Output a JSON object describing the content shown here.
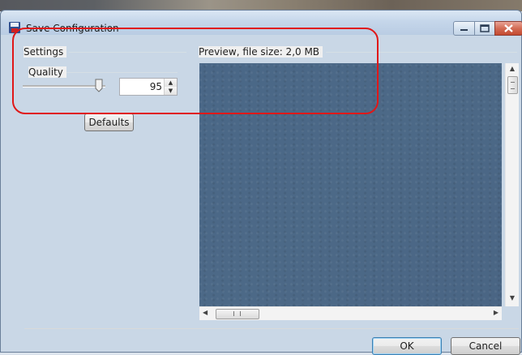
{
  "window": {
    "title": "Save Configuration",
    "icon": "save-icon",
    "controls": {
      "minimize": "minimize-icon",
      "maximize": "maximize-icon",
      "close": "close-icon"
    }
  },
  "settings": {
    "group_label": "Settings",
    "quality": {
      "label": "Quality",
      "value": "95",
      "slider_level": 0.95
    },
    "defaults_button": "Defaults"
  },
  "preview": {
    "label": "Preview, file size: 2,0 MB",
    "scrollbar_h_grip": "III"
  },
  "footer": {
    "ok_label": "OK",
    "cancel_label": "Cancel"
  },
  "colors": {
    "annotation": "#e01818",
    "preview_bg": "#4b6786",
    "close_button": "#c4492f"
  }
}
